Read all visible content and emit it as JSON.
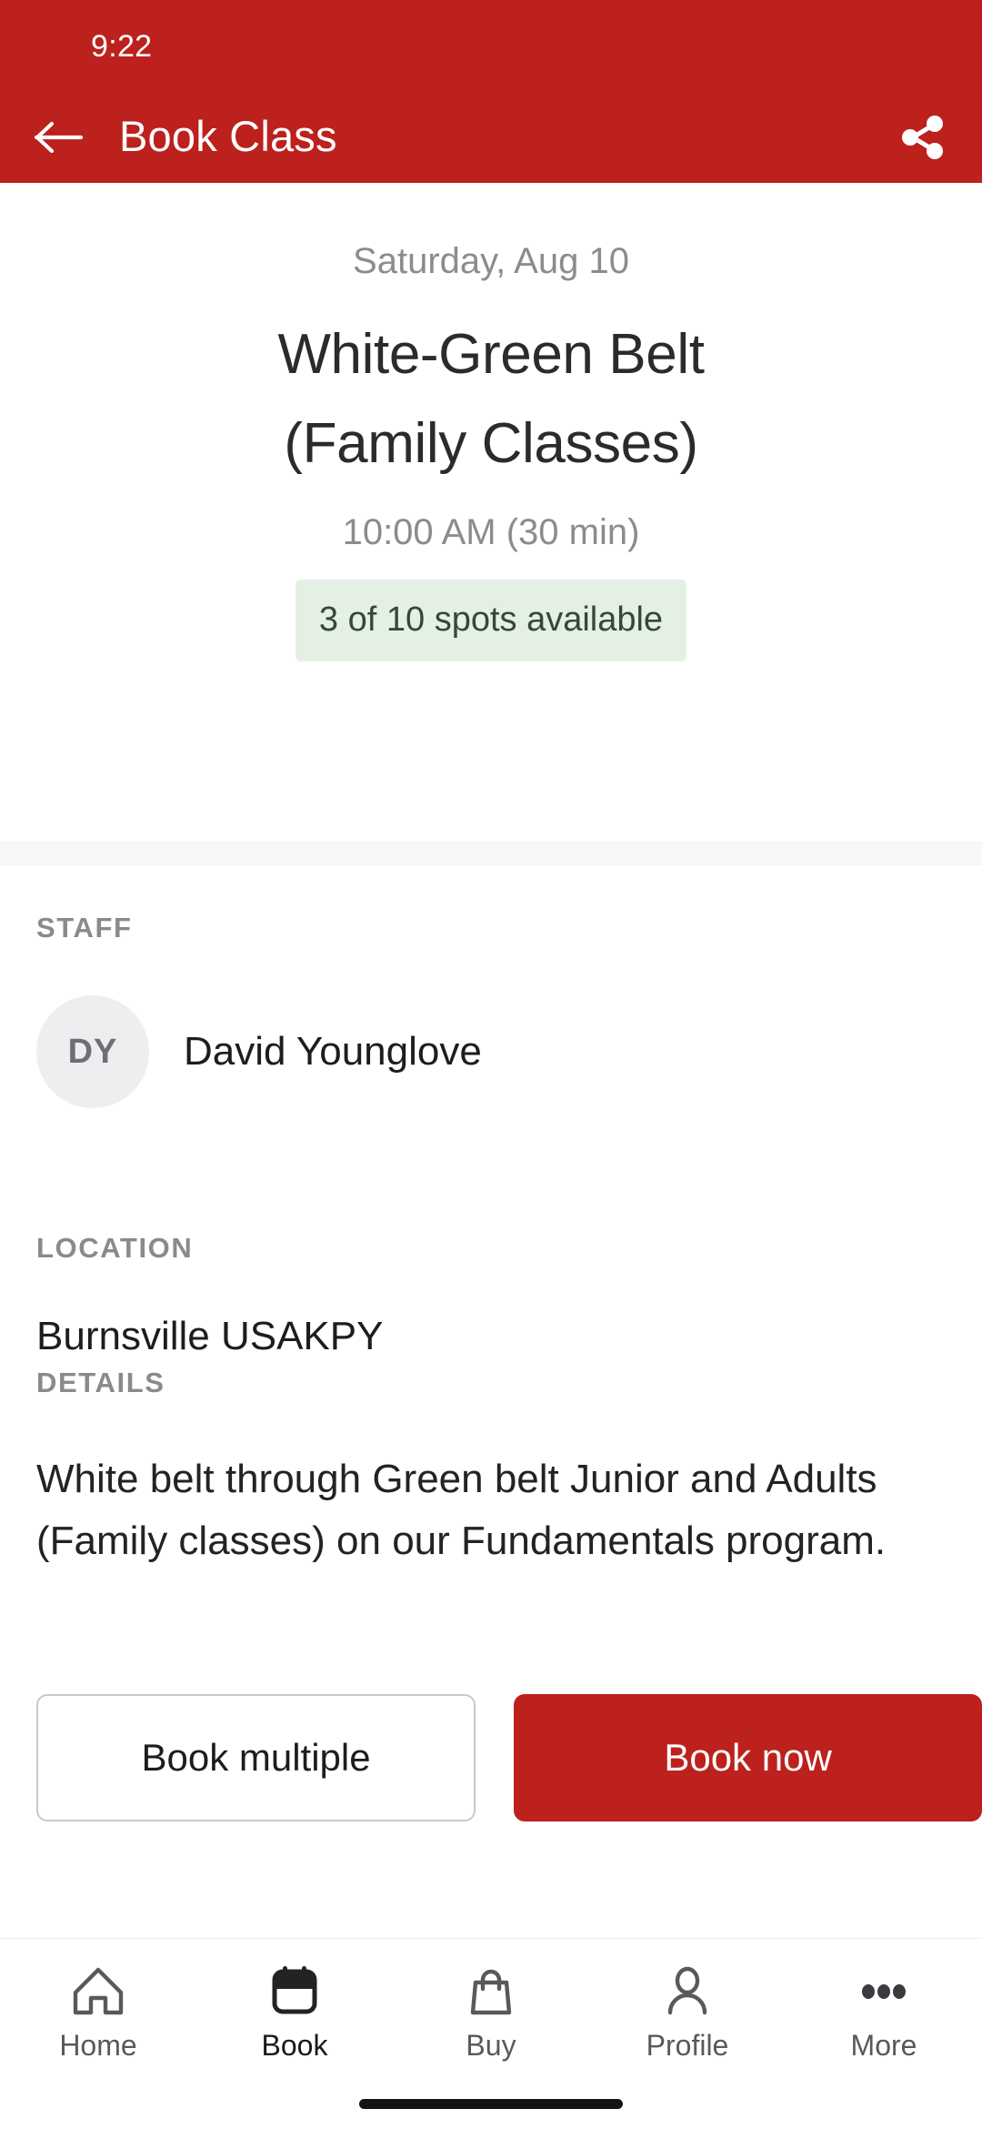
{
  "statusbar": {
    "time": "9:22"
  },
  "header": {
    "title": "Book Class",
    "back_icon": "arrow-left-icon",
    "share_icon": "share-icon",
    "background_color": "#bc211d"
  },
  "hero": {
    "date": "Saturday, Aug 10",
    "title_line1": "White-Green Belt",
    "title_line2": "(Family Classes)",
    "time": "10:00 AM (30 min)",
    "availability": "3 of 10 spots available",
    "availability_bg": "#e4f0e4",
    "availability_color": "#33483a"
  },
  "sections": {
    "staff": {
      "label": "STAFF",
      "avatar_initials": "DY",
      "name": "David Younglove"
    },
    "location": {
      "label": "LOCATION",
      "value": "Burnsville USAKPY"
    },
    "details": {
      "label": "DETAILS",
      "value": "White belt through Green belt Junior and Adults (Family classes) on our Fundamentals program."
    }
  },
  "actions": {
    "secondary_label": "Book multiple",
    "primary_label": "Book now",
    "primary_color": "#bc211d"
  },
  "bottom_nav": {
    "items": [
      {
        "label": "Home",
        "icon": "home-icon",
        "active": false
      },
      {
        "label": "Book",
        "icon": "calendar-icon",
        "active": true
      },
      {
        "label": "Buy",
        "icon": "bag-icon",
        "active": false
      },
      {
        "label": "Profile",
        "icon": "person-icon",
        "active": false
      },
      {
        "label": "More",
        "icon": "ellipsis-icon",
        "active": false
      }
    ]
  }
}
